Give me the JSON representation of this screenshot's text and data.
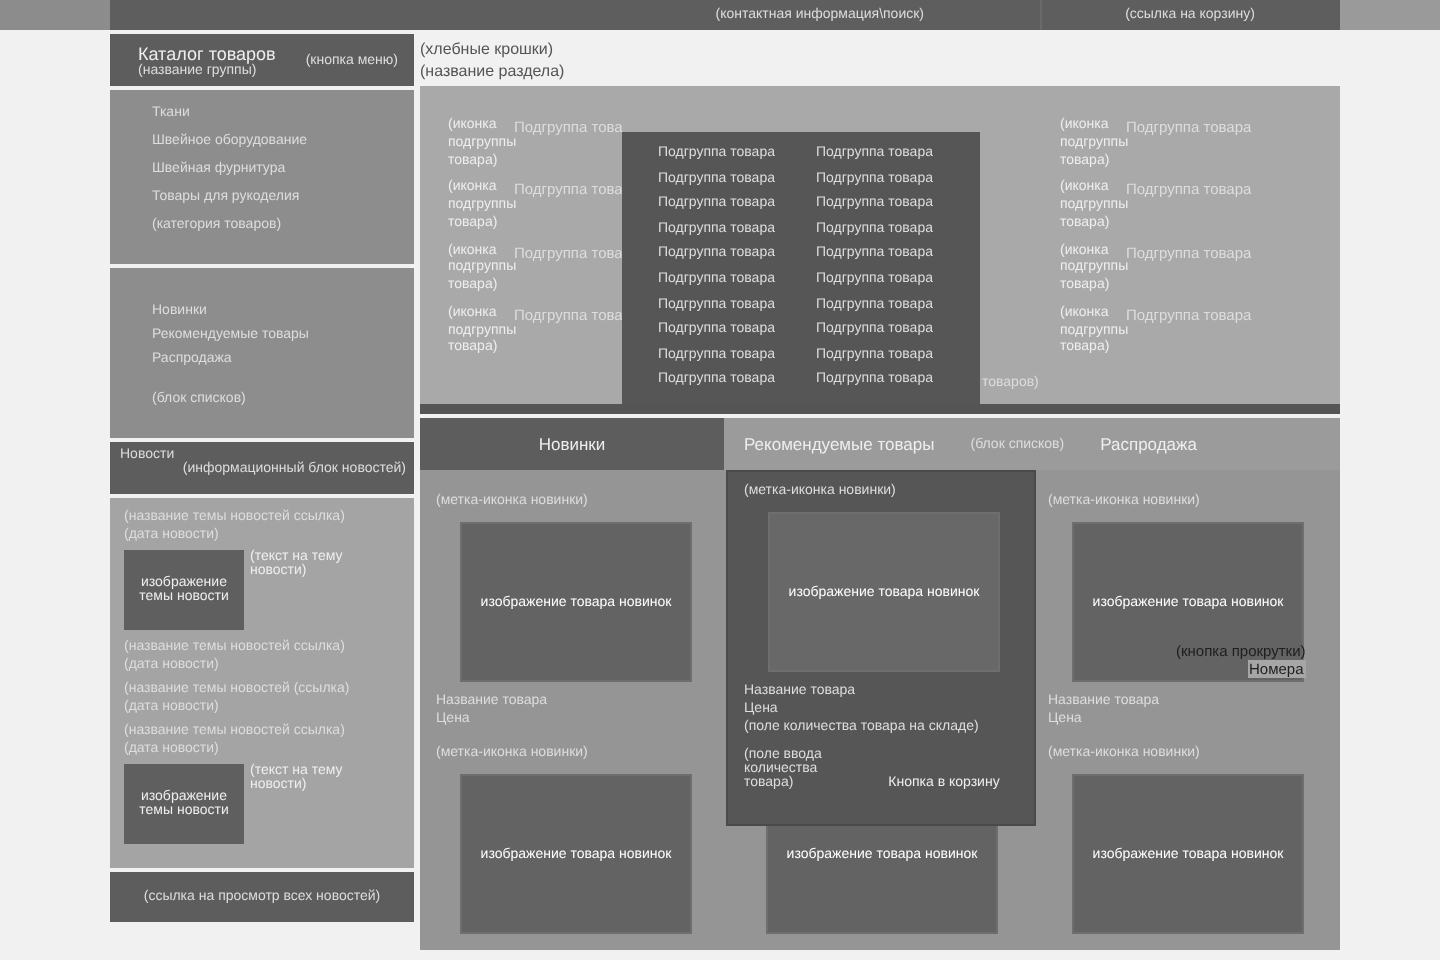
{
  "header": {
    "contacts": "(контактная информация\\поиск)",
    "cart_link": "(ссылка на корзину)"
  },
  "catalog": {
    "title": "Катaлог товаров",
    "group": "(название группы)",
    "menu_button": "(кнопка меню)",
    "items": [
      "Ткани",
      "Швейное оборудование",
      "Швейная фурнитура",
      "Товары для рукоделия",
      "(категория товаров)"
    ]
  },
  "lists": {
    "items": [
      "Новинки",
      "Рекомендуемые товары",
      "Распродажа"
    ],
    "note": "(блок списков)"
  },
  "news": {
    "title": "Новости",
    "subtitle": "(информационный блок новостей)",
    "items": [
      {
        "title": "(название темы новостей ссылка)",
        "date": "(дата новости)",
        "image_text": "изображение темы новости",
        "text": "(текст на тему новости)"
      },
      {
        "title": "(название темы новостей ссылка)",
        "date": "(дата новости)"
      },
      {
        "title": "(название темы новостей (ссылка)",
        "date": "(дата новости)"
      },
      {
        "title": "(название темы новостей ссылка)",
        "date": "(дата новости)",
        "image_text": "изображение темы новости",
        "text": "(текст на тему новости)"
      }
    ],
    "all_link": "(ссылка на просмотр всех новостей)"
  },
  "breadcrumbs": "(хлебные крошки)",
  "section_title": "(название раздела)",
  "subgroups": {
    "left": [
      {
        "icon": "(иконка подгруппы товара)",
        "name": "Подгруппа това"
      },
      {
        "icon": "(иконка подгруппы товара)",
        "name": "Подгруппа това"
      },
      {
        "icon": "(иконка подгруппы товара)",
        "name": "Подгруппа това"
      },
      {
        "icon": "(иконка подгруппы товара)",
        "name": "Подгруппа това"
      }
    ],
    "right": [
      {
        "icon": "(иконка подгруппы товара)",
        "name": "Подгруппа товара"
      },
      {
        "icon": "(иконка подгруппы товара)",
        "name": "Подгруппа товара"
      },
      {
        "icon": "(иконка подгруппы товара)",
        "name": "Подгруппа товара"
      },
      {
        "icon": "(иконка подгруппы товара)",
        "name": "Подгруппа товара"
      }
    ],
    "fragment": "товаров)",
    "dropdown": [
      [
        "Подгруппа товара",
        "Подгруппа товара"
      ],
      [
        "Подгруппа товара",
        "Подгруппа товара"
      ],
      [
        "Подгруппа товара",
        "Подгруппа товара"
      ],
      [
        "Подгруппа товара",
        "Подгруппа товара"
      ],
      [
        "Подгруппа товара",
        "Подгруппа товара"
      ],
      [
        "Подгруппа товара",
        "Подгруппа товара"
      ],
      [
        "Подгруппа товара",
        "Подгруппа товара"
      ],
      [
        "Подгруппа товара",
        "Подгруппа товара"
      ],
      [
        "Подгруппа товара",
        "Подгруппа товара"
      ],
      [
        "Подгруппа товара",
        "Подгруппа товара"
      ]
    ]
  },
  "products": {
    "tabs": [
      {
        "label": "Новинки",
        "selected": true
      },
      {
        "label": "Рекомендуемые товары",
        "selected": false
      },
      {
        "label": "Распродажа",
        "selected": false
      }
    ],
    "tabs_note": "(блок списков)",
    "cards": [
      {
        "kind": "plain",
        "badge": "(метка-иконка новинки)",
        "image_text": "изображение товара новинок",
        "name": "Название товара",
        "price": "Цена"
      },
      {
        "kind": "hover",
        "badge": "(метка-иконка новинки)",
        "image_text": "изображение товара новинок",
        "name": "Название товара",
        "price": "Цена",
        "stock": "(поле количества товара  на складе)",
        "qty": "(поле ввода количества товара)",
        "cart_button": "Кнопка в корзину"
      },
      {
        "kind": "plain",
        "badge": "(метка-иконка новинки)",
        "image_text": "изображение товара новинок",
        "name": "Название товара",
        "price": "Цена"
      },
      {
        "kind": "image",
        "badge": "(метка-иконка новинки)",
        "image_text": "изображение товара новинок"
      },
      {
        "kind": "image",
        "image_text": "изображение товара новинок"
      },
      {
        "kind": "image",
        "badge": "(метка-иконка новинки)",
        "image_text": "изображение товара новинок"
      }
    ],
    "scroll_button": "(кнопка прокрутки)",
    "scroll_numbers": "Номера"
  }
}
